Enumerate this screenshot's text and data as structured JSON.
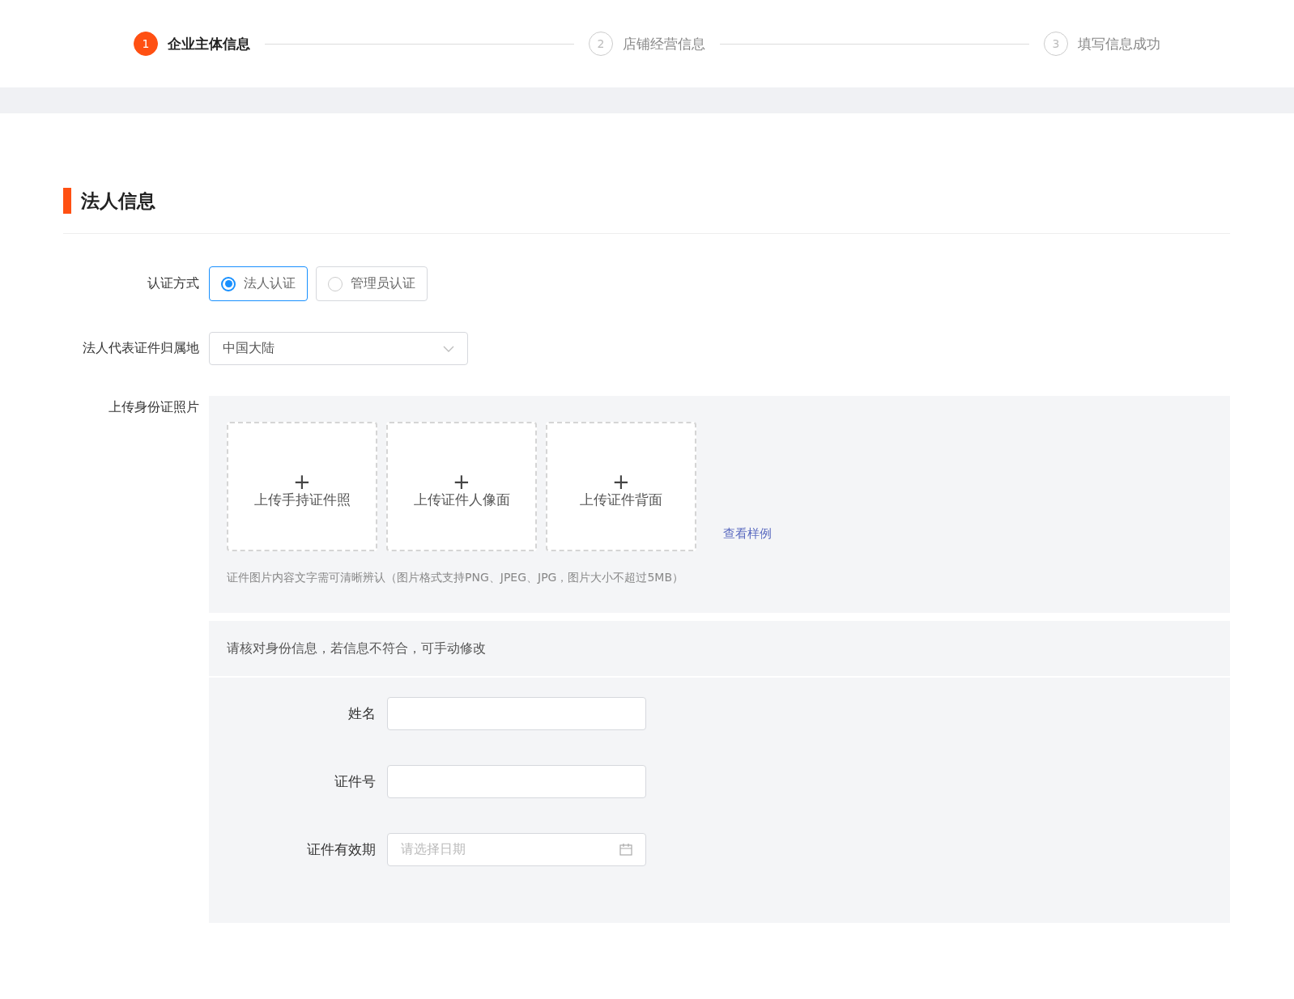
{
  "steps": [
    {
      "number": "1",
      "label": "企业主体信息",
      "active": true
    },
    {
      "number": "2",
      "label": "店铺经营信息",
      "active": false
    },
    {
      "number": "3",
      "label": "填写信息成功",
      "active": false
    }
  ],
  "section_title": "法人信息",
  "auth_method": {
    "label": "认证方式",
    "options": [
      {
        "label": "法人认证",
        "selected": true
      },
      {
        "label": "管理员认证",
        "selected": false
      }
    ]
  },
  "region": {
    "label": "法人代表证件归属地",
    "value": "中国大陆"
  },
  "upload": {
    "label": "上传身份证照片",
    "slots": [
      {
        "plus": "+",
        "label": "上传手持证件照"
      },
      {
        "plus": "+",
        "label": "上传证件人像面"
      },
      {
        "plus": "+",
        "label": "上传证件背面"
      }
    ],
    "sample_link": "查看样例",
    "hint": "证件图片内容文字需可清晰辨认（图片格式支持PNG、JPEG、JPG，图片大小不超过5MB）"
  },
  "verify": {
    "notice": "请核对身份信息，若信息不符合，可手动修改",
    "fields": [
      {
        "label": "姓名",
        "kind": "text"
      },
      {
        "label": "证件号",
        "kind": "text"
      },
      {
        "label": "证件有效期",
        "kind": "date",
        "placeholder": "请选择日期"
      }
    ]
  }
}
